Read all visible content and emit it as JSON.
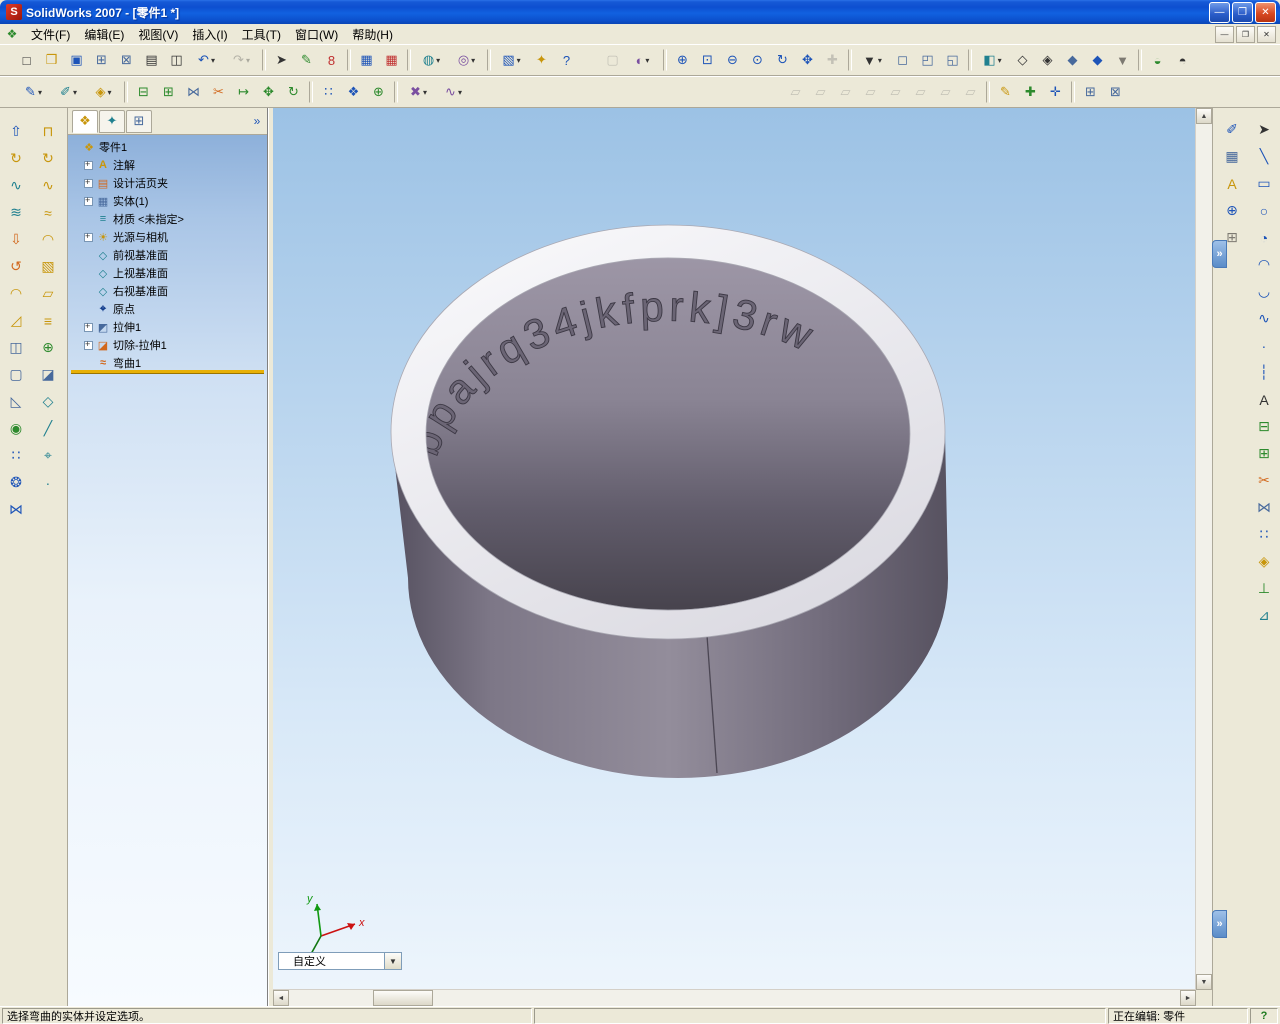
{
  "title_bar": {
    "app_icon_glyph": "S",
    "title": "SolidWorks 2007 - [零件1 *]",
    "buttons": [
      {
        "name": "minimize-button",
        "glyph": "—"
      },
      {
        "name": "restore-button",
        "glyph": "❐"
      },
      {
        "name": "close-button",
        "glyph": "✕"
      }
    ]
  },
  "menu": {
    "doc_icon_glyph": "❖",
    "items": [
      {
        "id": "menu-file",
        "label": "文件(F)"
      },
      {
        "id": "menu-edit",
        "label": "编辑(E)"
      },
      {
        "id": "menu-view",
        "label": "视图(V)"
      },
      {
        "id": "menu-insert",
        "label": "插入(I)"
      },
      {
        "id": "menu-tools",
        "label": "工具(T)"
      },
      {
        "id": "menu-window",
        "label": "窗口(W)"
      },
      {
        "id": "menu-help",
        "label": "帮助(H)"
      }
    ],
    "mdi_buttons": [
      {
        "id": "mdi-minimize-button",
        "glyph": "—"
      },
      {
        "id": "mdi-restore-button",
        "glyph": "❐"
      },
      {
        "id": "mdi-close-button",
        "glyph": "✕"
      }
    ]
  },
  "toolbars": {
    "row1_left": [
      {
        "id": "new-document-icon",
        "glyph": "□",
        "tint": "dark"
      },
      {
        "id": "open-document-icon",
        "glyph": "❒",
        "tint": "gold"
      },
      {
        "id": "save-icon",
        "glyph": "▣",
        "tint": "blue"
      },
      {
        "id": "make-drawing-from-part-icon",
        "glyph": "⊞",
        "tint": "steel"
      },
      {
        "id": "make-assembly-from-part-icon",
        "glyph": "⊠",
        "tint": "steel"
      },
      {
        "id": "print-icon",
        "glyph": "▤",
        "tint": "dark"
      },
      {
        "id": "print-preview-icon",
        "glyph": "◫",
        "tint": "dark"
      },
      {
        "id": "undo-icon",
        "glyph": "↶",
        "tint": "blue",
        "dd": true
      },
      {
        "id": "redo-icon",
        "glyph": "↷",
        "tint": "blue",
        "dd": true,
        "disabled": true
      },
      {
        "sep": true,
        "inter": "false"
      },
      {
        "id": "select-icon",
        "glyph": "➤",
        "tint": "dark"
      },
      {
        "id": "edit-color-icon",
        "glyph": "✎",
        "tint": "green"
      },
      {
        "id": "appearance-icon",
        "glyph": "8",
        "tint": "red"
      },
      {
        "sep": true,
        "inter": "false"
      },
      {
        "id": "design-table-icon",
        "glyph": "▦",
        "tint": "blue"
      },
      {
        "id": "equations-icon",
        "glyph": "▦",
        "tint": "red"
      },
      {
        "sep": true,
        "inter": "false"
      },
      {
        "id": "selection-filter-toggle-icon",
        "glyph": "◍",
        "tint": "teal",
        "dd": true
      },
      {
        "id": "selection-filters-icon",
        "glyph": "◎",
        "tint": "purple",
        "dd": true
      },
      {
        "sep": true,
        "inter": "false"
      },
      {
        "id": "document-properties-icon",
        "glyph": "▧",
        "tint": "blue",
        "dd": true
      },
      {
        "id": "measure-icon",
        "glyph": "✦",
        "tint": "gold"
      },
      {
        "id": "help-icon",
        "glyph": "?",
        "tint": "blue"
      }
    ],
    "row1_right": [
      {
        "id": "view-settings-icon",
        "glyph": "▢",
        "tint": "gray",
        "disabled": true
      },
      {
        "id": "edit-appearance-icon",
        "glyph": "◐",
        "tint": "purple",
        "dd": true
      },
      {
        "sep": true,
        "inter": "false"
      },
      {
        "id": "zoom-to-fit-icon",
        "glyph": "⊕",
        "tint": "blue"
      },
      {
        "id": "zoom-to-area-icon",
        "glyph": "⊡",
        "tint": "blue"
      },
      {
        "id": "zoom-in-out-icon",
        "glyph": "⊖",
        "tint": "blue"
      },
      {
        "id": "zoom-to-selection-icon",
        "glyph": "⊙",
        "tint": "blue"
      },
      {
        "id": "rotate-view-icon",
        "glyph": "↻",
        "tint": "blue"
      },
      {
        "id": "pan-icon",
        "glyph": "✥",
        "tint": "blue"
      },
      {
        "id": "3d-drawing-view-icon",
        "glyph": "✚",
        "tint": "gray",
        "disabled": true
      },
      {
        "sep": true,
        "inter": "false"
      },
      {
        "id": "view-orientation-icon",
        "glyph": "▼",
        "tint": "dark",
        "dd": true
      },
      {
        "id": "front-view-icon",
        "glyph": "◻",
        "tint": "steel"
      },
      {
        "id": "left-view-icon",
        "glyph": "◰",
        "tint": "steel"
      },
      {
        "id": "isometric-view-icon",
        "glyph": "◱",
        "tint": "steel"
      },
      {
        "sep": true,
        "inter": "false"
      },
      {
        "id": "section-view-icon",
        "glyph": "◧",
        "tint": "teal",
        "dd": true
      },
      {
        "id": "wireframe-display-icon",
        "glyph": "◇",
        "tint": "dark"
      },
      {
        "id": "hidden-lines-display-icon",
        "glyph": "◈",
        "tint": "dark"
      },
      {
        "id": "shaded-with-edges-display-icon",
        "glyph": "◆",
        "tint": "steel"
      },
      {
        "id": "shaded-display-icon",
        "glyph": "◆",
        "tint": "blue"
      },
      {
        "id": "shadows-display-icon",
        "glyph": "▼",
        "tint": "gray"
      },
      {
        "sep": true,
        "inter": "false"
      },
      {
        "id": "curvature-display-icon",
        "glyph": "◒",
        "tint": "green"
      },
      {
        "id": "zebra-stripes-icon",
        "glyph": "◓",
        "tint": "dark"
      }
    ],
    "row2_left": [
      {
        "id": "sketch-icon",
        "glyph": "✎",
        "tint": "blue",
        "dd": true
      },
      {
        "id": "3d-sketch-icon",
        "glyph": "✐",
        "tint": "teal",
        "dd": true
      },
      {
        "id": "smart-dimension-icon",
        "glyph": "◈",
        "tint": "gold",
        "dd": true
      },
      {
        "sep": true,
        "inter": "false"
      },
      {
        "id": "convert-entities-icon",
        "glyph": "⊟",
        "tint": "green"
      },
      {
        "id": "offset-entities-icon",
        "glyph": "⊞",
        "tint": "green"
      },
      {
        "id": "mirror-entities-icon",
        "glyph": "⋈",
        "tint": "steel"
      },
      {
        "id": "trim-entities-icon",
        "glyph": "✂",
        "tint": "orange"
      },
      {
        "id": "extend-entities-icon",
        "glyph": "↦",
        "tint": "green"
      },
      {
        "id": "move-entities-icon",
        "glyph": "✥",
        "tint": "green"
      },
      {
        "id": "rotate-entities-icon",
        "glyph": "↻",
        "tint": "green"
      },
      {
        "sep": true,
        "inter": "false"
      },
      {
        "id": "linear-sketch-pattern-icon",
        "glyph": "∷",
        "tint": "blue"
      },
      {
        "id": "circular-sketch-pattern-icon",
        "glyph": "❖",
        "tint": "blue"
      },
      {
        "id": "edit-sketch-pattern-icon",
        "glyph": "⊕",
        "tint": "green"
      },
      {
        "sep": true,
        "inter": "false"
      },
      {
        "id": "quick-snaps-icon",
        "glyph": "✖",
        "tint": "purple",
        "dd": true
      },
      {
        "id": "spline-tools-icon",
        "glyph": "∿",
        "tint": "purple",
        "dd": true
      }
    ],
    "row2_right": [
      {
        "id": "show-planes-icon",
        "glyph": "▱",
        "tint": "gray",
        "disabled": true
      },
      {
        "id": "show-axes-icon",
        "glyph": "▱",
        "tint": "gray",
        "disabled": true
      },
      {
        "id": "show-origins-icon",
        "glyph": "▱",
        "tint": "gray",
        "disabled": true
      },
      {
        "id": "show-sketches-icon",
        "glyph": "▱",
        "tint": "gray",
        "disabled": true
      },
      {
        "id": "show-curves-icon",
        "glyph": "▱",
        "tint": "gray",
        "disabled": true
      },
      {
        "id": "show-coordinate-systems-icon",
        "glyph": "▱",
        "tint": "gray",
        "disabled": true
      },
      {
        "id": "show-annotations-icon",
        "glyph": "▱",
        "tint": "gray",
        "disabled": true
      },
      {
        "id": "show-lights-icon",
        "glyph": "▱",
        "tint": "gray",
        "disabled": true
      },
      {
        "sep": true,
        "inter": "false"
      },
      {
        "id": "instant-3d-icon",
        "glyph": "✎",
        "tint": "gold"
      },
      {
        "id": "rapid-sketch-icon",
        "glyph": "✚",
        "tint": "green"
      },
      {
        "id": "dimension-expert-icon",
        "glyph": "✛",
        "tint": "blue"
      },
      {
        "sep": true,
        "inter": "false"
      },
      {
        "id": "feature-statistics-icon",
        "glyph": "⊞",
        "tint": "steel"
      },
      {
        "id": "geometry-analysis-icon",
        "glyph": "⊠",
        "tint": "steel"
      }
    ]
  },
  "left_toolbar": {
    "col1": [
      {
        "id": "extruded-boss-icon",
        "glyph": "⇧",
        "tint": "blue"
      },
      {
        "id": "revolved-boss-icon",
        "glyph": "↻",
        "tint": "gold"
      },
      {
        "id": "swept-boss-icon",
        "glyph": "∿",
        "tint": "teal"
      },
      {
        "id": "lofted-boss-icon",
        "glyph": "≋",
        "tint": "teal"
      },
      {
        "id": "extruded-cut-icon",
        "glyph": "⇩",
        "tint": "orange"
      },
      {
        "id": "revolved-cut-icon",
        "glyph": "↺",
        "tint": "orange"
      },
      {
        "id": "fillet-icon",
        "glyph": "◠",
        "tint": "gold"
      },
      {
        "id": "chamfer-icon",
        "glyph": "◿",
        "tint": "gold"
      },
      {
        "id": "rib-icon",
        "glyph": "◫",
        "tint": "steel"
      },
      {
        "id": "shell-icon",
        "glyph": "▢",
        "tint": "steel"
      },
      {
        "id": "draft-icon",
        "glyph": "◺",
        "tint": "steel"
      },
      {
        "id": "hole-wizard-icon",
        "glyph": "◉",
        "tint": "green"
      },
      {
        "id": "linear-pattern-icon",
        "glyph": "∷",
        "tint": "blue"
      },
      {
        "id": "circular-pattern-icon",
        "glyph": "❂",
        "tint": "blue"
      },
      {
        "id": "mirror-feature-icon",
        "glyph": "⋈",
        "tint": "blue"
      }
    ],
    "col2": [
      {
        "id": "extruded-surface-icon",
        "glyph": "⊓",
        "tint": "gold"
      },
      {
        "id": "revolved-surface-icon",
        "glyph": "↻",
        "tint": "gold"
      },
      {
        "id": "swept-surface-icon",
        "glyph": "∿",
        "tint": "gold"
      },
      {
        "id": "lofted-surface-icon",
        "glyph": "≈",
        "tint": "gold"
      },
      {
        "id": "boundary-surface-icon",
        "glyph": "◠",
        "tint": "gold"
      },
      {
        "id": "filled-surface-icon",
        "glyph": "▧",
        "tint": "gold"
      },
      {
        "id": "planar-surface-icon",
        "glyph": "▱",
        "tint": "gold"
      },
      {
        "id": "offset-surface-icon",
        "glyph": "≡",
        "tint": "gold"
      },
      {
        "id": "knit-surface-icon",
        "glyph": "⊕",
        "tint": "green"
      },
      {
        "id": "thicken-icon",
        "glyph": "◪",
        "tint": "steel"
      },
      {
        "id": "reference-plane-icon",
        "glyph": "◇",
        "tint": "teal"
      },
      {
        "id": "reference-axis-icon",
        "glyph": "╱",
        "tint": "teal"
      },
      {
        "id": "coordinate-system-icon",
        "glyph": "⌖",
        "tint": "teal"
      },
      {
        "id": "reference-point-icon",
        "glyph": "∙",
        "tint": "teal"
      }
    ]
  },
  "right_toolbar": {
    "col1": [
      {
        "id": "3d-sketch-tool-icon",
        "glyph": "✐",
        "tint": "blue"
      },
      {
        "id": "standard-views-icon",
        "glyph": "▦",
        "tint": "steel"
      },
      {
        "id": "annotations-tool-icon",
        "glyph": "A",
        "tint": "gold"
      },
      {
        "id": "zoom-tool-icon",
        "glyph": "⊕",
        "tint": "blue"
      },
      {
        "id": "layer-properties-icon",
        "glyph": "⊞",
        "tint": "gray"
      }
    ],
    "col2": [
      {
        "id": "select-tool-icon",
        "glyph": "➤",
        "tint": "dark"
      },
      {
        "id": "line-tool-icon",
        "glyph": "╲",
        "tint": "blue"
      },
      {
        "id": "rectangle-tool-icon",
        "glyph": "▭",
        "tint": "blue"
      },
      {
        "id": "circle-tool-icon",
        "glyph": "○",
        "tint": "blue"
      },
      {
        "id": "centerpoint-arc-tool-icon",
        "glyph": "◔",
        "tint": "blue"
      },
      {
        "id": "tangent-arc-tool-icon",
        "glyph": "◠",
        "tint": "blue"
      },
      {
        "id": "three-point-arc-tool-icon",
        "glyph": "◡",
        "tint": "blue"
      },
      {
        "id": "spline-tool-icon",
        "glyph": "∿",
        "tint": "blue"
      },
      {
        "id": "point-tool-icon",
        "glyph": "∙",
        "tint": "blue"
      },
      {
        "id": "centerline-tool-icon",
        "glyph": "┆",
        "tint": "blue"
      },
      {
        "id": "text-tool-icon",
        "glyph": "A",
        "tint": "dark"
      },
      {
        "id": "convert-entities-tool-icon",
        "glyph": "⊟",
        "tint": "green"
      },
      {
        "id": "offset-entities-tool-icon",
        "glyph": "⊞",
        "tint": "green"
      },
      {
        "id": "trim-tool-icon",
        "glyph": "✂",
        "tint": "orange"
      },
      {
        "id": "mirror-tool-icon",
        "glyph": "⋈",
        "tint": "steel"
      },
      {
        "id": "linear-pattern-tool-icon",
        "glyph": "∷",
        "tint": "blue"
      },
      {
        "id": "smart-dimension-tool-icon",
        "glyph": "◈",
        "tint": "gold"
      },
      {
        "id": "add-relation-tool-icon",
        "glyph": "⊥",
        "tint": "green"
      },
      {
        "id": "display-relations-tool-icon",
        "glyph": "⊿",
        "tint": "teal"
      }
    ]
  },
  "panel": {
    "expand_glyph": "»",
    "tabs": [
      {
        "id": "featuremanager-tab",
        "glyph": "❖",
        "tint": "gold"
      },
      {
        "id": "propertymanager-tab",
        "glyph": "✦",
        "tint": "teal"
      },
      {
        "id": "configurationmanager-tab",
        "glyph": "⊞",
        "tint": "steel"
      }
    ]
  },
  "feature_tree": {
    "items": [
      {
        "id": "tree-item-part1",
        "label": "零件1",
        "icon": "part-icon",
        "glyph": "❖",
        "tint": "gold",
        "level": 0
      },
      {
        "id": "tree-item-annotations",
        "label": "注解",
        "icon": "annotations-folder-icon",
        "glyph": "A",
        "tint": "gold",
        "level": 1,
        "expandable": true
      },
      {
        "id": "tree-item-design-binder",
        "label": "设计活页夹",
        "icon": "design-binder-icon",
        "glyph": "▤",
        "tint": "orange",
        "level": 1,
        "expandable": true
      },
      {
        "id": "tree-item-solid-bodies",
        "label": "实体(1)",
        "icon": "solid-bodies-folder-icon",
        "glyph": "▦",
        "tint": "steel",
        "level": 1,
        "expandable": true
      },
      {
        "id": "tree-item-material",
        "label": "材质 <未指定>",
        "icon": "material-icon",
        "glyph": "≡",
        "tint": "teal",
        "level": 1
      },
      {
        "id": "tree-item-lights-cameras",
        "label": "光源与相机",
        "icon": "lights-cameras-folder-icon",
        "glyph": "☀",
        "tint": "gold",
        "level": 1,
        "expandable": true
      },
      {
        "id": "tree-item-front-plane",
        "label": "前视基准面",
        "icon": "plane-icon",
        "glyph": "◇",
        "tint": "teal",
        "level": 1
      },
      {
        "id": "tree-item-top-plane",
        "label": "上视基准面",
        "icon": "plane-icon",
        "glyph": "◇",
        "tint": "teal",
        "level": 1
      },
      {
        "id": "tree-item-right-plane",
        "label": "右视基准面",
        "icon": "plane-icon",
        "glyph": "◇",
        "tint": "teal",
        "level": 1
      },
      {
        "id": "tree-item-origin",
        "label": "原点",
        "icon": "origin-icon",
        "glyph": "⌖",
        "tint": "navy",
        "level": 1
      },
      {
        "id": "tree-item-extrude1",
        "label": "拉伸1",
        "icon": "extrude-feature-icon",
        "glyph": "◩",
        "tint": "steel",
        "level": 1,
        "expandable": true
      },
      {
        "id": "tree-item-cut-extrude1",
        "label": "切除-拉伸1",
        "icon": "cut-extrude-feature-icon",
        "glyph": "◪",
        "tint": "orange",
        "level": 1,
        "expandable": true
      },
      {
        "id": "tree-item-flex1",
        "label": "弯曲1",
        "icon": "flex-feature-icon",
        "glyph": "≈",
        "tint": "orange",
        "level": 1
      }
    ]
  },
  "viewport": {
    "engraving": "bpajrq34jkfprk]3rw",
    "view_selector": {
      "value": "自定义"
    },
    "triad": {
      "x_label": "x",
      "y_label": "y"
    }
  },
  "scrollbars": {
    "up": "▲",
    "down": "▼",
    "left": "◄",
    "right": "►"
  },
  "status_bar": {
    "message": "选择弯曲的实体并设定选项。",
    "editing_label": "正在编辑: 零件",
    "help_glyph": "?"
  },
  "colors": {
    "titlebar_blue": "#0d4fd0",
    "toolbar_beige": "#ece9d8",
    "viewport_top": "#9cc2e5",
    "viewport_bottom": "#edf5fc",
    "ring_body": "#8b8593",
    "ring_top": "#f2f1f4",
    "rollback_yellow": "#e8b005"
  }
}
